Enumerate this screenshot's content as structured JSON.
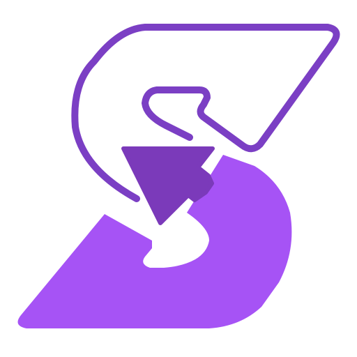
{
  "logo": {
    "name": "s-cursor-logo",
    "colors": {
      "outline": "#7b3fc4",
      "fill": "#a653f5",
      "cursor": "#7b3aba",
      "background": "#ffffff"
    },
    "icons": [
      "s-letter-outline",
      "s-letter-fill",
      "cursor-arrow-icon"
    ]
  }
}
